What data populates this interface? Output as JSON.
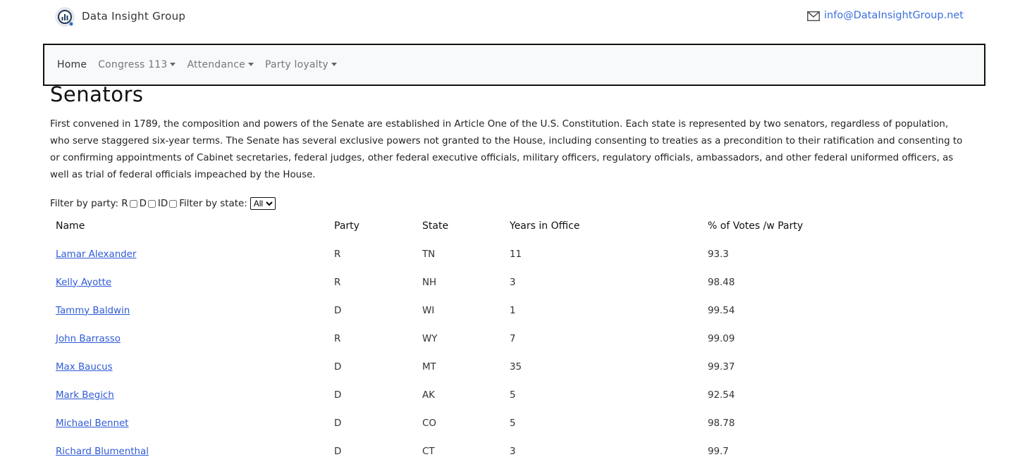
{
  "header": {
    "brand": "Data Insight Group",
    "email": "info@DataInsightGroup.net"
  },
  "nav": [
    {
      "label": "Home",
      "dropdown": false,
      "active": true
    },
    {
      "label": "Congress 113",
      "dropdown": true
    },
    {
      "label": "Attendance",
      "dropdown": true
    },
    {
      "label": "Party loyalty",
      "dropdown": true
    }
  ],
  "page": {
    "title": "Senators",
    "intro": "First convened in 1789, the composition and powers of the Senate are established in Article One of the U.S. Constitution. Each state is represented by two senators, regardless of population, who serve staggered six-year terms. The Senate has several exclusive powers not granted to the House, including consenting to treaties as a precondition to their ratification and consenting to or confirming appointments of Cabinet secretaries, federal judges, other federal executive officials, military officers, regulatory officials, ambassadors, and other federal uniformed officers, as well as trial of federal officials impeached by the House."
  },
  "filters": {
    "party_label": "Filter by party:",
    "parties": [
      "R",
      "D",
      "ID"
    ],
    "state_label": "Filter by state:",
    "state_selected": "All"
  },
  "table": {
    "headers": [
      "Name",
      "Party",
      "State",
      "Years in Office",
      "% of Votes /w Party"
    ],
    "rows": [
      {
        "name": "Lamar Alexander",
        "party": "R",
        "state": "TN",
        "years": "11",
        "pct": "93.3"
      },
      {
        "name": "Kelly Ayotte",
        "party": "R",
        "state": "NH",
        "years": "3",
        "pct": "98.48"
      },
      {
        "name": "Tammy Baldwin",
        "party": "D",
        "state": "WI",
        "years": "1",
        "pct": "99.54"
      },
      {
        "name": "John Barrasso",
        "party": "R",
        "state": "WY",
        "years": "7",
        "pct": "99.09"
      },
      {
        "name": "Max Baucus",
        "party": "D",
        "state": "MT",
        "years": "35",
        "pct": "99.37"
      },
      {
        "name": "Mark Begich",
        "party": "D",
        "state": "AK",
        "years": "5",
        "pct": "92.54"
      },
      {
        "name": "Michael Bennet",
        "party": "D",
        "state": "CO",
        "years": "5",
        "pct": "98.78"
      },
      {
        "name": "Richard Blumenthal",
        "party": "D",
        "state": "CT",
        "years": "3",
        "pct": "99.7"
      }
    ]
  },
  "colors": {
    "link": "#2f5bd6",
    "email": "#3b6fe0",
    "navbar_bg": "#f8f9fa"
  }
}
